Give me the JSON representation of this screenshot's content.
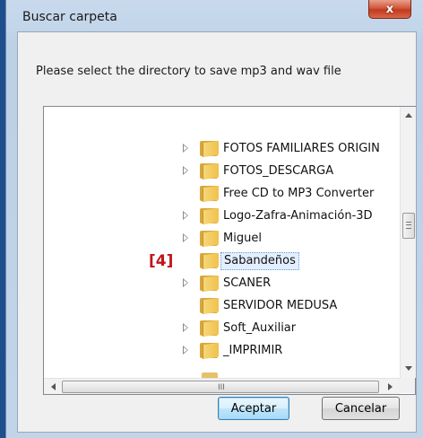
{
  "window": {
    "title": "Buscar carpeta",
    "close_glyph": "x"
  },
  "instruction": "Please select the directory to save mp3 and wav file",
  "tree": {
    "items": [
      {
        "label": "FOTOS FAMILIARES ORIGIN",
        "expandable": true
      },
      {
        "label": "FOTOS_DESCARGA",
        "expandable": true
      },
      {
        "label": "Free CD to MP3 Converter",
        "expandable": false
      },
      {
        "label": "Logo-Zafra-Animación-3D",
        "expandable": true
      },
      {
        "label": "Miguel",
        "expandable": true
      },
      {
        "label": "Sabandeños",
        "expandable": false,
        "selected": true
      },
      {
        "label": "SCANER",
        "expandable": true
      },
      {
        "label": "SERVIDOR MEDUSA",
        "expandable": false
      },
      {
        "label": "Soft_Auxiliar",
        "expandable": true
      },
      {
        "label": "_IMPRIMIR",
        "expandable": true
      }
    ],
    "annotation": "[4]",
    "hscroll_grip": "III"
  },
  "buttons": {
    "ok": "Aceptar",
    "cancel": "Cancelar"
  }
}
